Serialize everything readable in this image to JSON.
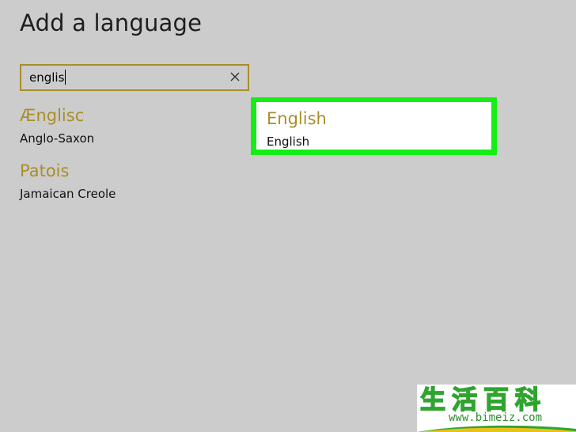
{
  "page": {
    "title": "Add a language"
  },
  "search": {
    "value": "englis",
    "clear_icon": "close-icon"
  },
  "results": [
    {
      "native": "Ænglisc",
      "english": "Anglo-Saxon",
      "selected": false
    },
    {
      "native": "English",
      "english": "English",
      "selected": true
    },
    {
      "native": "Patois",
      "english": "Jamaican Creole",
      "selected": false
    }
  ],
  "colors": {
    "accent": "#a98e2a",
    "highlight": "#15ee15",
    "background": "#cccccc"
  },
  "watermark": {
    "chars": [
      "生",
      "活",
      "百",
      "科"
    ],
    "url": "www.bimeiz.com"
  }
}
